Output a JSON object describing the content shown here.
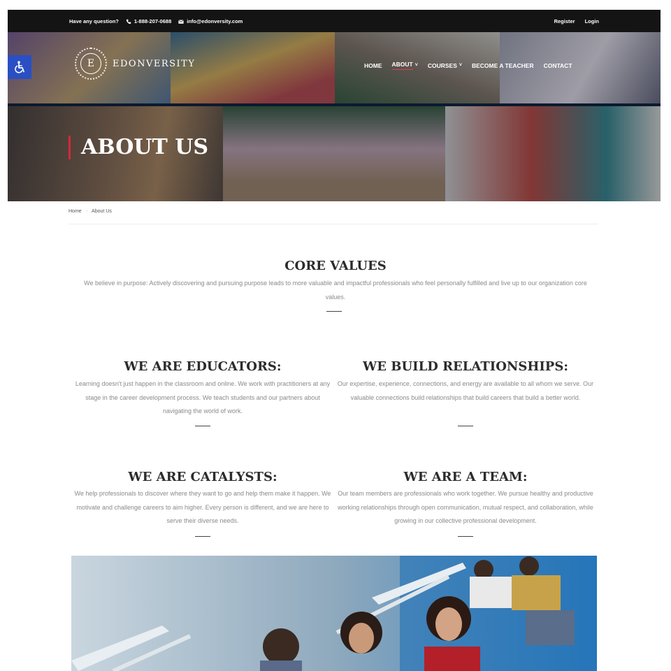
{
  "topbar": {
    "question": "Have any question?",
    "phone": "1-888-207-0688",
    "email": "info@edonversity.com",
    "register": "Register",
    "login": "Login"
  },
  "brand": {
    "logo_letter": "E",
    "name": "EDONVERSITY"
  },
  "nav": {
    "items": [
      {
        "label": "HOME"
      },
      {
        "label": "ABOUT"
      },
      {
        "label": "COURSES"
      },
      {
        "label": "BECOME A TEACHER"
      },
      {
        "label": "CONTACT"
      }
    ],
    "active": "ABOUT"
  },
  "hero": {
    "title": "ABOUT US"
  },
  "breadcrumb": {
    "home": "Home",
    "separator": "-",
    "current": "About Us"
  },
  "core": {
    "title": "CORE VALUES",
    "text": "We believe in purpose: Actively discovering and pursuing purpose leads to more valuable and impactful professionals who feel personally fulfilled and live up to our organization core values."
  },
  "values": [
    {
      "title": "WE ARE EDUCATORS:",
      "text": "Learning doesn't just happen in the classroom and online. We work with practitioners at any stage in the career development process. We teach students and our partners about navigating the world of work."
    },
    {
      "title": "WE BUILD RELATIONSHIPS:",
      "text": "Our expertise, experience, connections, and energy are available to all whom we serve. Our valuable connections build relationships that build careers that build a better world."
    },
    {
      "title": "WE ARE CATALYSTS:",
      "text": "We help professionals to discover where they want to go and help them make it happen. We motivate and challenge careers to aim higher. Every person is different, and we are here to serve their diverse needs."
    },
    {
      "title": "WE ARE A TEAM:",
      "text": "Our team members are professionals who work together. We pursue healthy and productive working relationships through open communication, mutual respect, and collaboration, while growing in our collective professional development."
    }
  ],
  "colors": {
    "topbar_bg": "#141414",
    "accent_red": "#d62839",
    "a11y_blue": "#2a4fc5",
    "heading": "#2c2c2c",
    "body_text": "#8a8a8a"
  },
  "icons": {
    "phone": "phone-icon",
    "email": "envelope-icon",
    "accessibility": "accessibility-icon",
    "dropdown": "chevron-down-icon"
  }
}
